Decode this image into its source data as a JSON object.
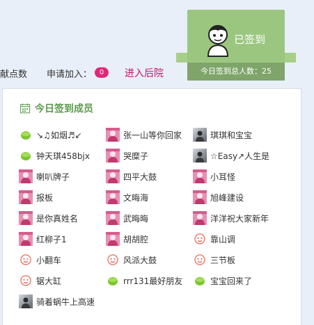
{
  "header": {
    "stat_fragment": "献点数",
    "apply_label": "申请加入：",
    "apply_count": "0",
    "enter_link": "进入后院"
  },
  "signin": {
    "status": "已签到",
    "total_label": "今日签到总人数：25"
  },
  "panel": {
    "title": "今日签到成员"
  },
  "colors": {
    "accent_green": "#9bc680",
    "title_green": "#5a9a4a",
    "badge_pink": "#e0267a",
    "link_magenta": "#c2136c"
  },
  "members": [
    {
      "name": "↘♫如烟♬↙",
      "avatar": "green-blob-icon"
    },
    {
      "name": "张一山等你回家",
      "avatar": "pink-avatar-icon"
    },
    {
      "name": "琪琪和宝宝",
      "avatar": "photo-avatar-icon"
    },
    {
      "name": "钟天琪458bjx",
      "avatar": "green-blob-icon"
    },
    {
      "name": "哭糜子",
      "avatar": "pink-avatar-icon"
    },
    {
      "name": "☆Easy↗人生是",
      "avatar": "photo-avatar-icon"
    },
    {
      "name": "喇叭牌子",
      "avatar": "pink-avatar-icon"
    },
    {
      "name": "四平大鼓",
      "avatar": "pink-avatar-icon"
    },
    {
      "name": "小耳怪",
      "avatar": "pink-avatar-icon"
    },
    {
      "name": "报板",
      "avatar": "pink-avatar-icon"
    },
    {
      "name": "文晦海",
      "avatar": "pink-avatar-icon"
    },
    {
      "name": "旭峰建设",
      "avatar": "pink-avatar-icon"
    },
    {
      "name": "是你真姓名",
      "avatar": "pink-avatar-icon"
    },
    {
      "name": "武晦晦",
      "avatar": "pink-avatar-icon"
    },
    {
      "name": "洋洋祝大家新年",
      "avatar": "pink-avatar-icon"
    },
    {
      "name": "红柳子1",
      "avatar": "pink-avatar-icon"
    },
    {
      "name": "胡胡腔",
      "avatar": "pink-avatar-icon"
    },
    {
      "name": "靠山调",
      "avatar": "red-face-icon"
    },
    {
      "name": "小翻车",
      "avatar": "red-face-icon"
    },
    {
      "name": "风派大鼓",
      "avatar": "red-face-icon"
    },
    {
      "name": "三节板",
      "avatar": "red-face-icon"
    },
    {
      "name": "锯大缸",
      "avatar": "red-face-icon"
    },
    {
      "name": "rrr131最好朋友",
      "avatar": "green-blob-icon"
    },
    {
      "name": "宝宝回来了",
      "avatar": "green-blob-icon"
    },
    {
      "name": "骑着蜗牛上高速",
      "avatar": "photo-avatar-icon"
    }
  ]
}
